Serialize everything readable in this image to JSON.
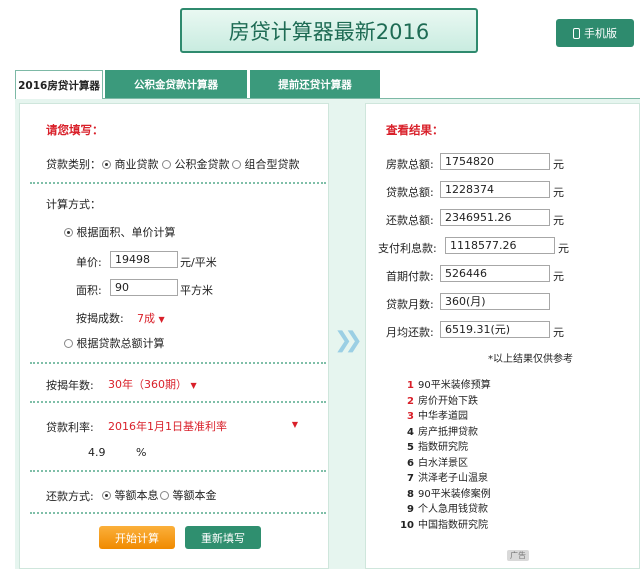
{
  "header": {
    "title": "房贷计算器最新2016",
    "mobile_label": "手机版"
  },
  "tabs": [
    {
      "label": "2016房贷计算器",
      "active": true
    },
    {
      "label": "公积金贷款计算器",
      "active": false
    },
    {
      "label": "提前还贷计算器",
      "active": false
    }
  ],
  "form": {
    "section_title": "请您填写：",
    "loan_type_label": "贷款类别：",
    "loan_type_options": [
      "商业贷款",
      "公积金贷款",
      "组合型贷款"
    ],
    "loan_type_selected": "商业贷款",
    "calc_method_label": "计算方式：",
    "calc_method_options": [
      "根据面积、单价计算",
      "根据贷款总额计算"
    ],
    "calc_method_selected": "根据面积、单价计算",
    "unit_price_label": "单价:",
    "unit_price_value": "19498",
    "unit_price_unit": "元/平米",
    "area_label": "面积:",
    "area_value": "90",
    "area_unit": "平方米",
    "down_payment_label": "按揭成数:",
    "down_payment_value": "7成",
    "years_label": "按揭年数:",
    "years_value": "30年（360期）",
    "rate_label": "贷款利率:",
    "rate_value": "2016年1月1日基准利率",
    "rate_number": "4.9",
    "rate_unit": "%",
    "repay_label": "还款方式:",
    "repay_options": [
      "等额本息",
      "等额本金"
    ],
    "repay_selected": "等额本息",
    "start_button": "开始计算",
    "reset_button": "重新填写"
  },
  "results": {
    "section_title": "查看结果：",
    "rows": [
      {
        "label": "房款总额:",
        "value": "1754820",
        "unit": "元"
      },
      {
        "label": "贷款总额:",
        "value": "1228374",
        "unit": "元"
      },
      {
        "label": "还款总额:",
        "value": "2346951.26",
        "unit": "元"
      },
      {
        "label": "支付利息款:",
        "value": "1118577.26",
        "unit": "元"
      },
      {
        "label": "首期付款:",
        "value": "526446",
        "unit": "元"
      },
      {
        "label": "贷款月数:",
        "value": "360(月)",
        "unit": ""
      },
      {
        "label": "月均还款:",
        "value": "6519.31(元)",
        "unit": "元"
      }
    ],
    "note": "*以上结果仅供参考"
  },
  "ads": {
    "items": [
      {
        "num": "1",
        "text": "90平米装修预算"
      },
      {
        "num": "2",
        "text": "房价开始下跌"
      },
      {
        "num": "3",
        "text": "中华孝道园"
      },
      {
        "num": "4",
        "text": "房产抵押贷款"
      },
      {
        "num": "5",
        "text": "指数研究院"
      },
      {
        "num": "6",
        "text": "白水洋景区"
      },
      {
        "num": "7",
        "text": "洪泽老子山温泉"
      },
      {
        "num": "8",
        "text": "90平米装修案例"
      },
      {
        "num": "9",
        "text": "个人急用钱贷款"
      },
      {
        "num": "10",
        "text": "中国指数研究院"
      }
    ],
    "badge": "广告"
  },
  "colors": {
    "accent": "#2e8b6e",
    "highlight_red": "#d9202a",
    "orange_button": "#f39c12"
  }
}
